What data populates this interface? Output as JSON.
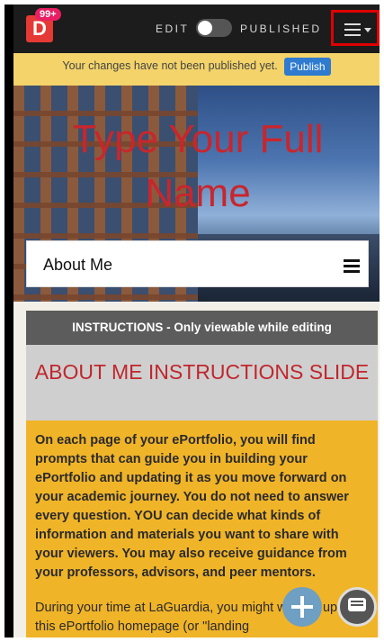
{
  "topbar": {
    "logo_letter": "D",
    "notification_count": "99+",
    "mode_edit_label": "EDIT",
    "mode_published_label": "PUBLISHED",
    "toggle_state": "off"
  },
  "notice": {
    "message": "Your changes have not been published yet.",
    "publish_label": "Publish"
  },
  "hero": {
    "title": "Type Your Full Name"
  },
  "nav": {
    "current_page": "About Me"
  },
  "instructions": {
    "header": "INSTRUCTIONS - Only viewable while editing",
    "title": "ABOUT ME INSTRUCTIONS SLIDE",
    "paragraph1": "On each page of your ePortfolio, you will find prompts that can guide you in building your ePortfolio and updating it as you move forward on your academic journey. You do not need to answer every question. YOU can decide what kinds of information and materials you want to share with your viewers. You may also receive guidance from your professors, advisors, and peer mentors.",
    "paragraph2": "During your time at LaGuardia, you might want to update this ePortfolio homepage (or \"landing"
  },
  "colors": {
    "accent_red": "#c8262c",
    "notice_yellow": "#f3d36a",
    "instruction_orange": "#f0b429",
    "publish_blue": "#2e7bcf",
    "highlight_red_border": "#e00000"
  },
  "icons": {
    "menu": "hamburger-menu-icon",
    "add": "plus-circle-icon",
    "chat": "chat-bubble-icon"
  }
}
